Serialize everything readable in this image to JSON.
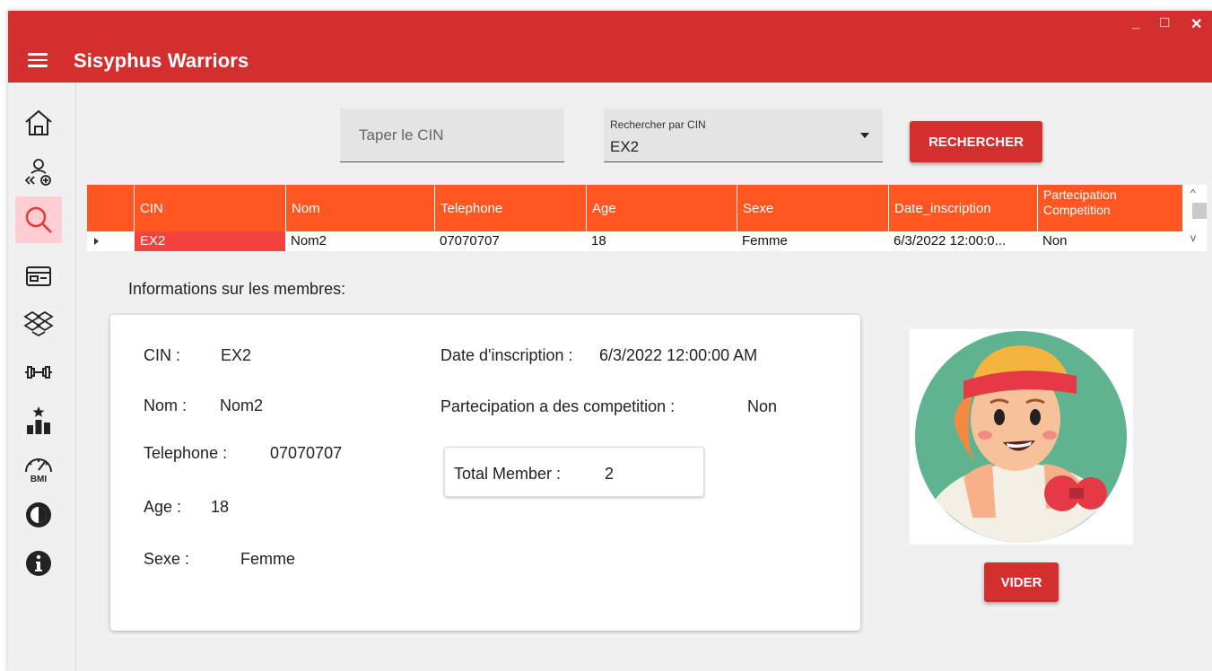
{
  "window": {
    "title": "Sisyphus Warriors",
    "controls": {
      "minimize": "_",
      "maximize": "□",
      "close": "✕"
    }
  },
  "sidebar": {
    "items": [
      {
        "icon": "home-icon",
        "active": false
      },
      {
        "icon": "add-members-icon",
        "active": false
      },
      {
        "icon": "search-icon",
        "active": true
      },
      {
        "icon": "membership-card-icon",
        "active": false
      },
      {
        "icon": "dropbox-icon",
        "active": false
      },
      {
        "icon": "dumbbell-icon",
        "active": false
      },
      {
        "icon": "ranking-icon",
        "active": false
      },
      {
        "icon": "bmi-gauge-icon",
        "active": false
      },
      {
        "icon": "contrast-icon",
        "active": false
      },
      {
        "icon": "info-icon",
        "active": false
      }
    ]
  },
  "search": {
    "cin_placeholder": "Taper le CIN",
    "cin_value": "",
    "select_label": "Rechercher par CIN",
    "select_value": "EX2",
    "button_label": "RECHERCHER"
  },
  "grid": {
    "columns": [
      "CIN",
      "Nom",
      "Telephone",
      "Age",
      "Sexe",
      "Date_inscription",
      "Partecipation Competition"
    ],
    "rows": [
      [
        "EX2",
        "Nom2",
        "07070707",
        "18",
        "Femme",
        "6/3/2022 12:00:0...",
        "Non"
      ]
    ],
    "scroll_up": "^",
    "scroll_down": "v"
  },
  "details": {
    "section_title": "Informations sur les membres:",
    "cin_label": "CIN :",
    "cin_value": "EX2",
    "nom_label": "Nom :",
    "nom_value": "Nom2",
    "telephone_label": "Telephone :",
    "telephone_value": "07070707",
    "age_label": "Age :",
    "age_value": "18",
    "sexe_label": "Sexe :",
    "sexe_value": "Femme",
    "date_label": "Date d'inscription :",
    "date_value": "6/3/2022 12:00:00 AM",
    "competition_label": "Partecipation a des competition :",
    "competition_value": "Non",
    "total_label": "Total Member :",
    "total_value": "2"
  },
  "clear_button_label": "VIDER",
  "colors": {
    "titlebar": "#d32f2f",
    "grid_header": "#ff5722",
    "selected_cell": "#f4433f",
    "active_nav": "#ffcdd2"
  }
}
